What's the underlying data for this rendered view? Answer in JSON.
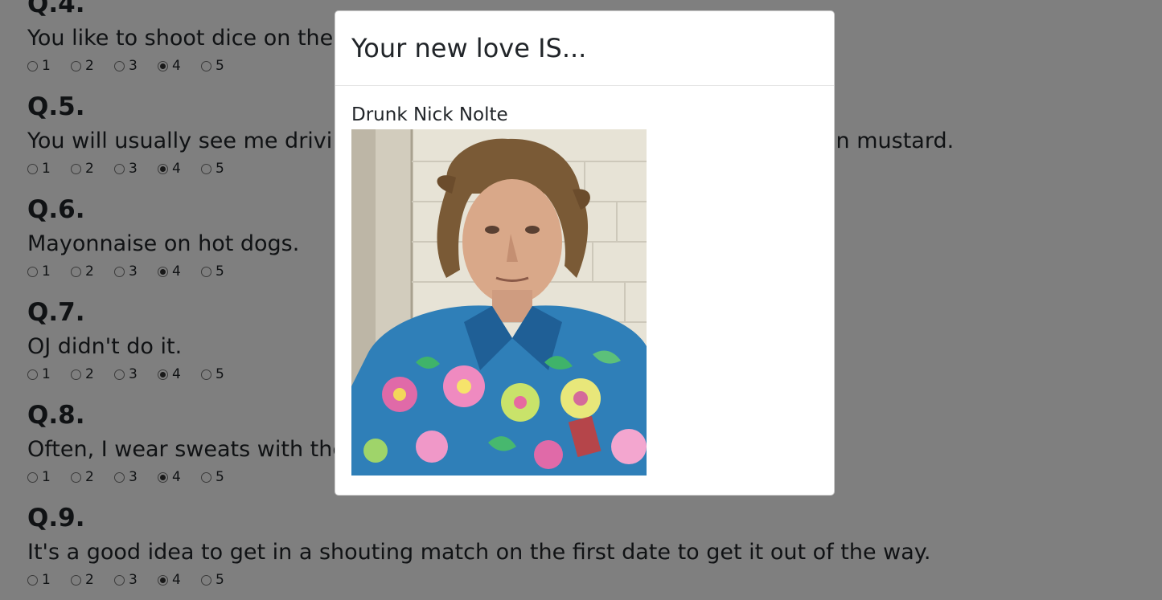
{
  "quiz": {
    "option_labels": [
      "1",
      "2",
      "3",
      "4",
      "5"
    ],
    "questions": [
      {
        "heading": "Q.4.",
        "text": "You like to shoot dice on the",
        "selected": 4
      },
      {
        "heading": "Q.5.",
        "text": "You will usually see me drivi                                                                ered in mustard.",
        "selected": 4
      },
      {
        "heading": "Q.6.",
        "text": "Mayonnaise on hot dogs.",
        "selected": 4
      },
      {
        "heading": "Q.7.",
        "text": "OJ didn't do it.",
        "selected": 4
      },
      {
        "heading": "Q.8.",
        "text": "Often, I wear sweats with the",
        "selected": 4
      },
      {
        "heading": "Q.9.",
        "text": "It's a good idea to get in a shouting match on the first date to get it out of the way.",
        "selected": 4
      }
    ]
  },
  "modal": {
    "title": "Your new love IS...",
    "result_name": "Drunk Nick Nolte",
    "photo_description": "mugshot-photo"
  }
}
